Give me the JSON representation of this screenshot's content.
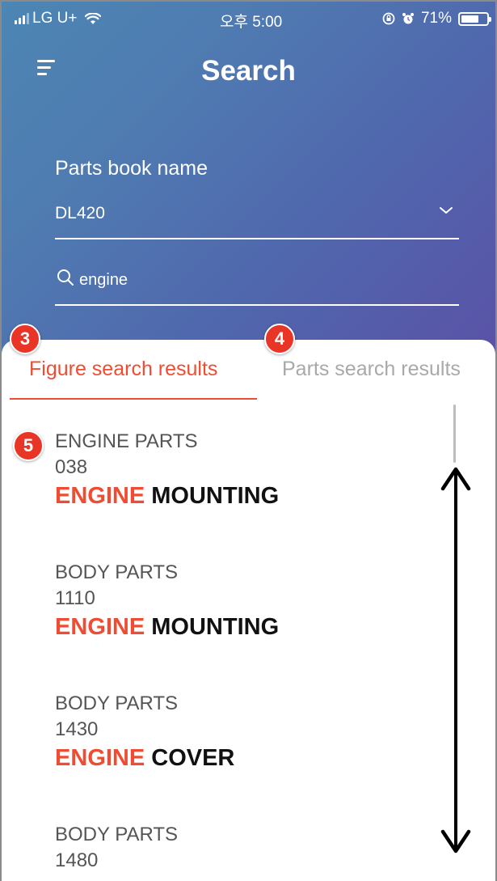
{
  "status_bar": {
    "carrier": "LG U+",
    "time": "오후 5:00",
    "battery_percent": "71%",
    "battery_level": 0.71,
    "icons": [
      "signal-icon",
      "wifi-icon",
      "rotation-lock-icon",
      "alarm-icon",
      "battery-icon"
    ]
  },
  "header": {
    "title": "Search",
    "menu_icon": "hamburger-menu-icon"
  },
  "parts_book": {
    "label": "Parts book name",
    "selected": "DL420"
  },
  "search": {
    "value": "engine",
    "icon": "search-icon"
  },
  "tabs": [
    {
      "label": "Figure search results",
      "active": true,
      "badge": "3"
    },
    {
      "label": "Parts search results",
      "active": false,
      "badge": "4"
    }
  ],
  "results_badge": "5",
  "results": [
    {
      "category": "ENGINE PARTS",
      "number": "038",
      "highlight": "ENGINE",
      "rest": "MOUNTING"
    },
    {
      "category": "BODY PARTS",
      "number": "1110",
      "highlight": "ENGINE",
      "rest": "MOUNTING"
    },
    {
      "category": "BODY PARTS",
      "number": "1430",
      "highlight": "ENGINE",
      "rest": "COVER"
    },
    {
      "category": "BODY PARTS",
      "number": "1480",
      "highlight": "",
      "rest": ""
    }
  ],
  "colors": {
    "accent": "#ee4d33",
    "badge": "#e83526",
    "header_gradient_start": "#4c86b4",
    "header_gradient_end": "#5a52a6"
  }
}
